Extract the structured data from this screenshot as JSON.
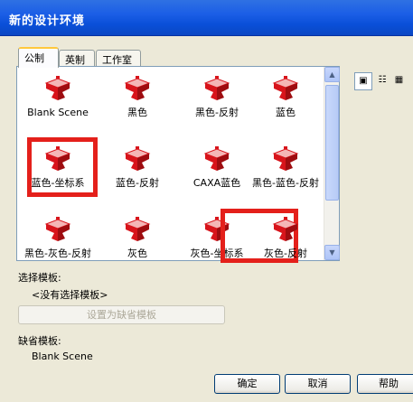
{
  "window": {
    "title": "新的设计环境"
  },
  "tabs": [
    {
      "label": "公制",
      "active": true
    },
    {
      "label": "英制",
      "active": false
    },
    {
      "label": "工作室",
      "active": false
    }
  ],
  "templates": [
    {
      "label": "Blank Scene"
    },
    {
      "label": "黑色"
    },
    {
      "label": "黑色-反射"
    },
    {
      "label": "蓝色"
    },
    {
      "label": "蓝色-坐标系",
      "highlighted": true
    },
    {
      "label": "蓝色-反射"
    },
    {
      "label": "CAXA蓝色"
    },
    {
      "label": "黑色-蓝色-反射"
    },
    {
      "label": "黑色-灰色-反射"
    },
    {
      "label": "灰色"
    },
    {
      "label": "灰色-坐标系",
      "highlighted": true
    },
    {
      "label": "灰色-反射"
    }
  ],
  "selected_template": {
    "label": "选择模板:",
    "value": "<没有选择模板>"
  },
  "set_default_button": "设置为缺省模板",
  "default_template": {
    "label": "缺省模板:",
    "value": "Blank Scene"
  },
  "buttons": {
    "ok": "确定",
    "cancel": "取消",
    "help": "帮助"
  },
  "colors": {
    "highlight": "#e4201b",
    "icon_red": "#d8141b",
    "titlebar": "#0a4fd8"
  }
}
